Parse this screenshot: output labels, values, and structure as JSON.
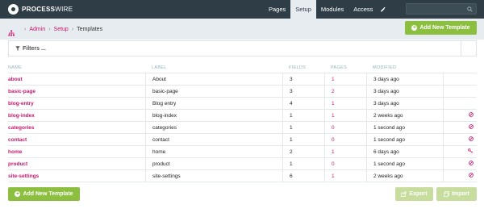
{
  "brand": {
    "bold": "PROCESS",
    "light": "WIRE"
  },
  "nav": {
    "items": [
      {
        "label": "Pages",
        "active": false
      },
      {
        "label": "Setup",
        "active": true
      },
      {
        "label": "Modules",
        "active": false
      },
      {
        "label": "Access",
        "active": false
      }
    ],
    "icons": {
      "tools": "wrench-icon",
      "search": "search-icon"
    }
  },
  "breadcrumb": {
    "items": [
      "Admin",
      "Setup"
    ],
    "current": "Templates"
  },
  "actions": {
    "add_template": "Add New Template",
    "export": "Export",
    "import": "Import"
  },
  "filters": {
    "label": "Filters ..."
  },
  "table": {
    "headers": {
      "name": "NAME",
      "label": "LABEL",
      "fields": "FIELDS",
      "pages": "PAGES",
      "modified": "MODIFIED"
    },
    "rows": [
      {
        "name": "about",
        "label": "About",
        "fields": "3",
        "pages": "1",
        "modified": "3 days ago",
        "action_icon": ""
      },
      {
        "name": "basic-page",
        "label": "basic-page",
        "fields": "3",
        "pages": "2",
        "modified": "3 days ago",
        "action_icon": ""
      },
      {
        "name": "blog-entry",
        "label": "Blog entry",
        "fields": "4",
        "pages": "1",
        "modified": "3 days ago",
        "action_icon": ""
      },
      {
        "name": "blog-index",
        "label": "blog-index",
        "fields": "1",
        "pages": "1",
        "modified": "2 weeks ago",
        "action_icon": "ban-icon"
      },
      {
        "name": "categories",
        "label": "categories",
        "fields": "1",
        "pages": "0",
        "modified": "1 second ago",
        "action_icon": "ban-icon"
      },
      {
        "name": "contact",
        "label": "contact",
        "fields": "1",
        "pages": "0",
        "modified": "1 second ago",
        "action_icon": "ban-icon"
      },
      {
        "name": "home",
        "label": "home",
        "fields": "2",
        "pages": "1",
        "modified": "6 days ago",
        "action_icon": "key-icon"
      },
      {
        "name": "product",
        "label": "product",
        "fields": "1",
        "pages": "0",
        "modified": "1 second ago",
        "action_icon": "ban-icon"
      },
      {
        "name": "site-settings",
        "label": "site-settings",
        "fields": "6",
        "pages": "1",
        "modified": "2 weeks ago",
        "action_icon": "ban-icon"
      }
    ]
  },
  "colors": {
    "accent": "#c4176e",
    "topbar": "#2f3e46",
    "button": "#8cbe3f",
    "button_muted": "#c6dd9d",
    "crumbbar": "#e6ecf0"
  }
}
